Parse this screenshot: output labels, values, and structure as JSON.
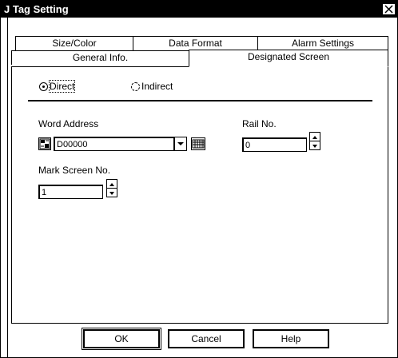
{
  "window": {
    "title": "J Tag Setting"
  },
  "tabs": {
    "row1": [
      {
        "label": "Size/Color"
      },
      {
        "label": "Data Format"
      },
      {
        "label": "Alarm Settings"
      }
    ],
    "row2": [
      {
        "label": "General Info."
      },
      {
        "label": "Designated Screen",
        "active": true
      }
    ]
  },
  "mode": {
    "direct_label": "Direct",
    "indirect_label": "Indirect",
    "selected": "Direct"
  },
  "word_address": {
    "label": "Word Address",
    "value": "D00000"
  },
  "rail_no": {
    "label": "Rail No.",
    "value": "0"
  },
  "mark_screen_no": {
    "label": "Mark Screen No.",
    "value": "1"
  },
  "buttons": {
    "ok": "OK",
    "cancel": "Cancel",
    "help": "Help"
  }
}
